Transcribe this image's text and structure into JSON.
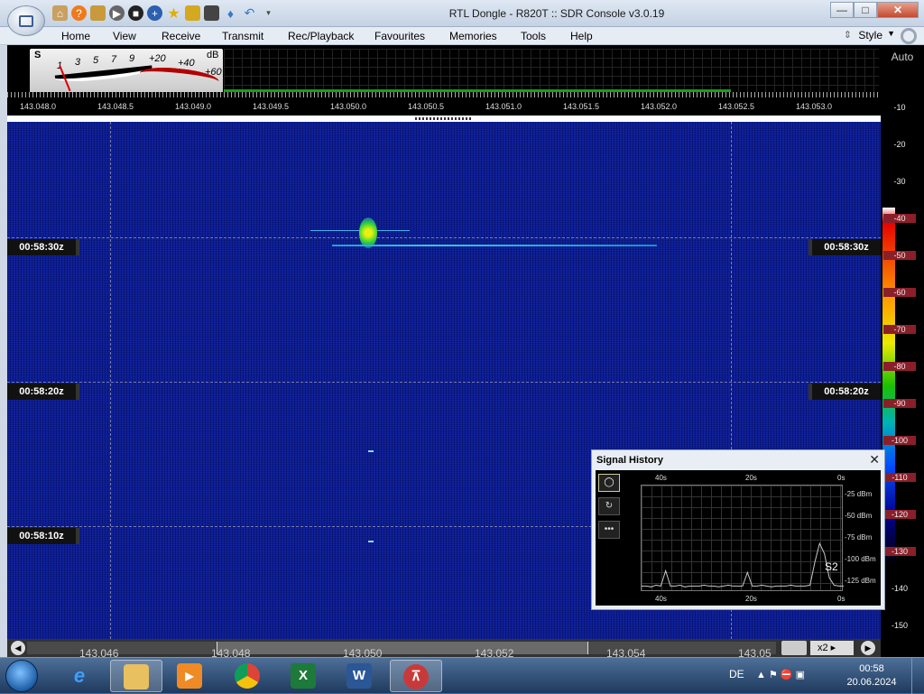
{
  "window": {
    "title": "RTL Dongle - R820T :: SDR Console v3.0.19",
    "controls": {
      "minimize": "—",
      "maximize": "□",
      "close": "✕"
    }
  },
  "quick_access": [
    "home-icon",
    "help-icon",
    "folder-icon",
    "play-icon",
    "stop-icon",
    "plus-icon",
    "star-icon",
    "lock-icon",
    "camera-icon",
    "drop-icon",
    "undo-icon",
    "dropdown-icon"
  ],
  "menu": {
    "items": [
      "Home",
      "View",
      "Receive",
      "Transmit",
      "Rec/Playback",
      "Favourites",
      "Memories",
      "Tools",
      "Help"
    ],
    "style_label": "Style"
  },
  "smeter": {
    "s_label": "S",
    "db_label": "dB",
    "scale": [
      "1",
      "3",
      "5",
      "7",
      "9"
    ],
    "over_scale": [
      "+20",
      "+40",
      "+60"
    ]
  },
  "spectrum": {
    "freq_labels": [
      "143.048.0",
      "143.048.5",
      "143.049.0",
      "143.049.5",
      "143.050.0",
      "143.050.5",
      "143.051.0",
      "143.051.5",
      "143.052.0",
      "143.052.5",
      "143.053.0"
    ]
  },
  "waterfall": {
    "timestamps": [
      "00:58:30z",
      "00:58:20z",
      "00:58:10z"
    ]
  },
  "scale_panel": {
    "auto_label": "Auto",
    "db_levels": [
      "-10",
      "-20",
      "-30",
      "-40",
      "-50",
      "-60",
      "-70",
      "-80",
      "-90",
      "-100",
      "-110",
      "-120",
      "-130",
      "-140",
      "-150"
    ]
  },
  "bottom_bar": {
    "freq_labels": [
      "143.046",
      "143.048",
      "143.050",
      "143.052",
      "143.054",
      "143.05"
    ],
    "zoom": "x2"
  },
  "signal_history": {
    "title": "Signal History",
    "close_label": "✕",
    "buttons": [
      "◯",
      "↻",
      "•••"
    ],
    "time_labels": [
      "40s",
      "20s",
      "0s"
    ],
    "dbm_labels": [
      "-25 dBm",
      "-50 dBm",
      "-75 dBm",
      "-100 dBm",
      "-125 dBm"
    ],
    "s_reading": "S2",
    "trace": [
      -128,
      -128,
      -129,
      -127,
      -128,
      -110,
      -128,
      -128,
      -127,
      -129,
      -128,
      -128,
      -128,
      -127,
      -128,
      -128,
      -129,
      -128,
      -127,
      -128,
      -128,
      -128,
      -112,
      -128,
      -128,
      -127,
      -128,
      -129,
      -128,
      -128,
      -128,
      -127,
      -128,
      -128,
      -128,
      -127,
      -100,
      -78,
      -90,
      -118,
      -127,
      -128,
      -128
    ]
  },
  "taskbar": {
    "apps": [
      "ie-icon",
      "explorer-icon",
      "media-player-icon",
      "chrome-icon",
      "excel-icon",
      "word-icon",
      "sdr-console-icon"
    ],
    "language": "DE",
    "time": "00:58",
    "date": "20.06.2024"
  }
}
